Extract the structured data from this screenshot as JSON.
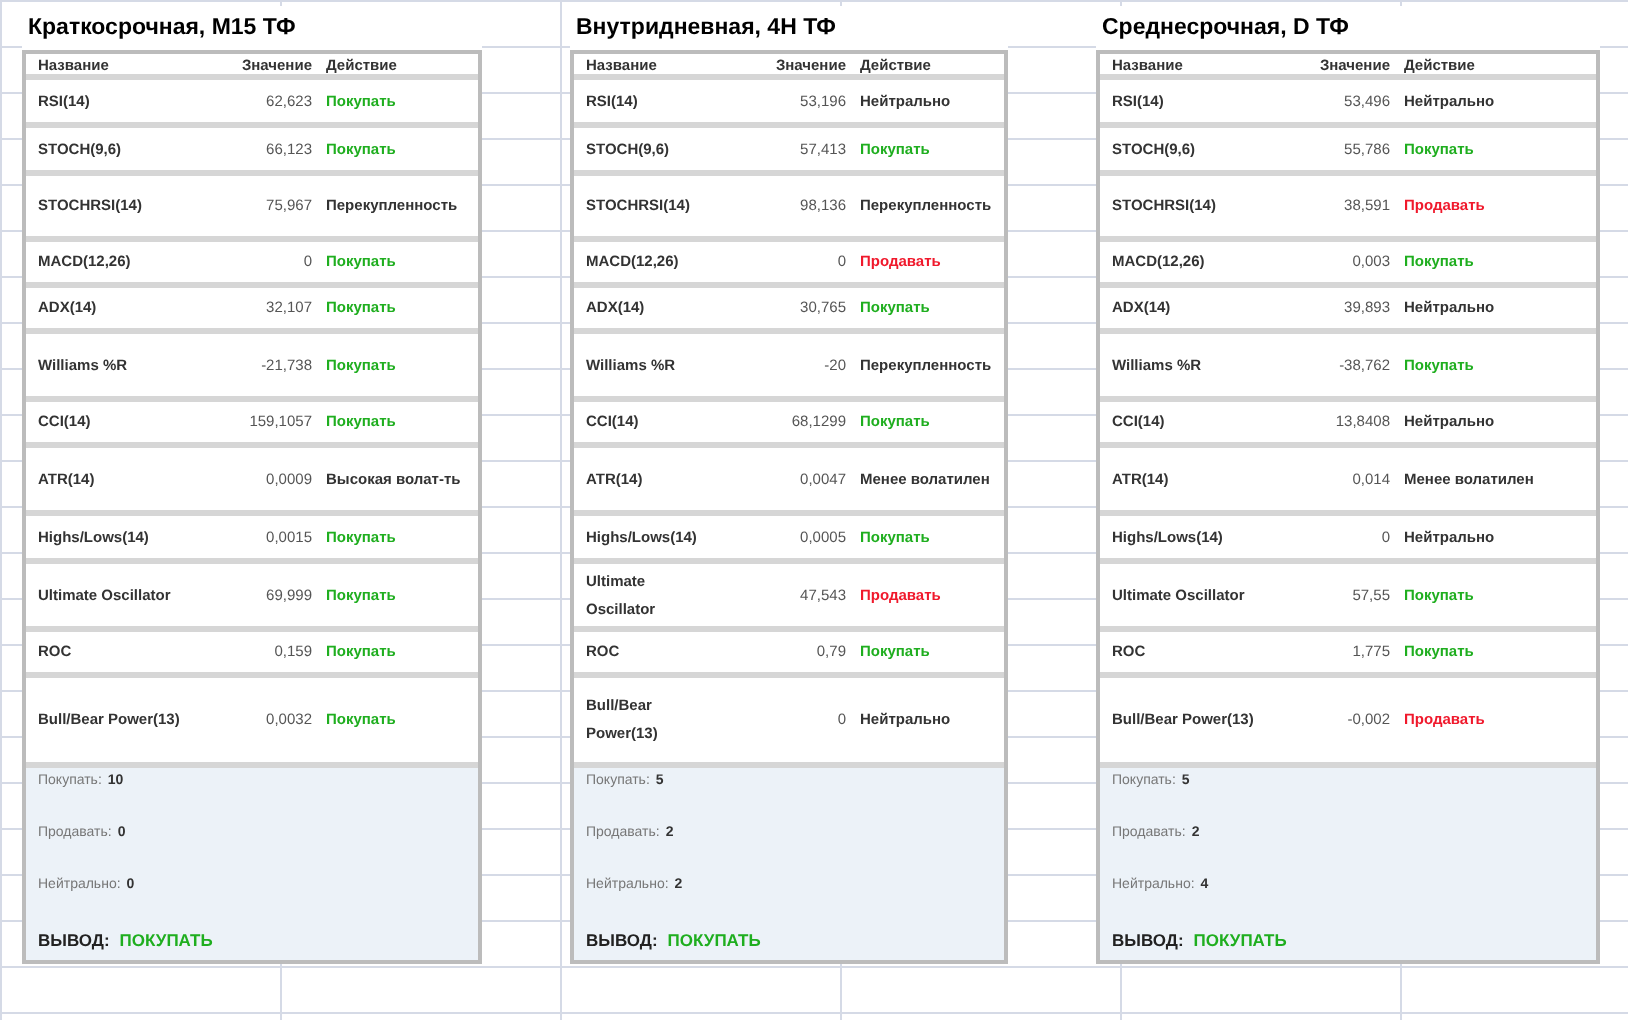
{
  "panels": [
    {
      "title": "Краткосрочная, M15 ТФ",
      "columns": [
        "Название",
        "Значение",
        "Действие"
      ],
      "rows": [
        {
          "name": "RSI(14)",
          "value": "62,623",
          "action": "Покупать",
          "kind": "buy"
        },
        {
          "name": "STOCH(9,6)",
          "value": "66,123",
          "action": "Покупать",
          "kind": "buy"
        },
        {
          "name": "STOCHRSI(14)",
          "value": "75,967",
          "action": "Перекупленность",
          "kind": "neutral"
        },
        {
          "name": "MACD(12,26)",
          "value": "0",
          "action": "Покупать",
          "kind": "buy"
        },
        {
          "name": "ADX(14)",
          "value": "32,107",
          "action": "Покупать",
          "kind": "buy"
        },
        {
          "name": "Williams %R",
          "value": "-21,738",
          "action": "Покупать",
          "kind": "buy"
        },
        {
          "name": "CCI(14)",
          "value": "159,1057",
          "action": "Покупать",
          "kind": "buy"
        },
        {
          "name": "ATR(14)",
          "value": "0,0009",
          "action": "Высокая волат-ть",
          "kind": "neutral"
        },
        {
          "name": "Highs/Lows(14)",
          "value": "0,0015",
          "action": "Покупать",
          "kind": "buy"
        },
        {
          "name": "Ultimate Oscillator",
          "value": "69,999",
          "action": "Покупать",
          "kind": "buy"
        },
        {
          "name": "ROC",
          "value": "0,159",
          "action": "Покупать",
          "kind": "buy"
        },
        {
          "name": "Bull/Bear Power(13)",
          "value": "0,0032",
          "action": "Покупать",
          "kind": "buy"
        }
      ],
      "summary": [
        {
          "label": "Покупать:",
          "count": "10"
        },
        {
          "label": "Продавать:",
          "count": "0"
        },
        {
          "label": "Нейтрально:",
          "count": "0"
        }
      ],
      "conclusion": {
        "label": "ВЫВОД:",
        "value": "ПОКУПАТЬ",
        "kind": "buy"
      }
    },
    {
      "title": "Внутридневная, 4H ТФ",
      "columns": [
        "Название",
        "Значение",
        "Действие"
      ],
      "rows": [
        {
          "name": "RSI(14)",
          "value": "53,196",
          "action": "Нейтрально",
          "kind": "neutral"
        },
        {
          "name": "STOCH(9,6)",
          "value": "57,413",
          "action": "Покупать",
          "kind": "buy"
        },
        {
          "name": "STOCHRSI(14)",
          "value": "98,136",
          "action": "Перекупленность",
          "kind": "neutral"
        },
        {
          "name": "MACD(12,26)",
          "value": "0",
          "action": "Продавать",
          "kind": "sell"
        },
        {
          "name": "ADX(14)",
          "value": "30,765",
          "action": "Покупать",
          "kind": "buy"
        },
        {
          "name": "Williams %R",
          "value": "-20",
          "action": "Перекупленность",
          "kind": "neutral"
        },
        {
          "name": "CCI(14)",
          "value": "68,1299",
          "action": "Покупать",
          "kind": "buy"
        },
        {
          "name": "ATR(14)",
          "value": "0,0047",
          "action": "Менее волатилен",
          "kind": "neutral"
        },
        {
          "name": "Highs/Lows(14)",
          "value": "0,0005",
          "action": "Покупать",
          "kind": "buy"
        },
        {
          "name": "Ultimate Oscillator",
          "value": "47,543",
          "action": "Продавать",
          "kind": "sell"
        },
        {
          "name": "ROC",
          "value": "0,79",
          "action": "Покупать",
          "kind": "buy"
        },
        {
          "name": "Bull/Bear Power(13)",
          "value": "0",
          "action": "Нейтрально",
          "kind": "neutral"
        }
      ],
      "summary": [
        {
          "label": "Покупать:",
          "count": "5"
        },
        {
          "label": "Продавать:",
          "count": "2"
        },
        {
          "label": "Нейтрально:",
          "count": "2"
        }
      ],
      "conclusion": {
        "label": "ВЫВОД:",
        "value": "ПОКУПАТЬ",
        "kind": "buy"
      }
    },
    {
      "title": "Среднесрочная, D ТФ",
      "columns": [
        "Название",
        "Значение",
        "Действие"
      ],
      "rows": [
        {
          "name": "RSI(14)",
          "value": "53,496",
          "action": "Нейтрально",
          "kind": "neutral"
        },
        {
          "name": "STOCH(9,6)",
          "value": "55,786",
          "action": "Покупать",
          "kind": "buy"
        },
        {
          "name": "STOCHRSI(14)",
          "value": "38,591",
          "action": "Продавать",
          "kind": "sell"
        },
        {
          "name": "MACD(12,26)",
          "value": "0,003",
          "action": "Покупать",
          "kind": "buy"
        },
        {
          "name": "ADX(14)",
          "value": "39,893",
          "action": "Нейтрально",
          "kind": "neutral"
        },
        {
          "name": "Williams %R",
          "value": "-38,762",
          "action": "Покупать",
          "kind": "buy"
        },
        {
          "name": "CCI(14)",
          "value": "13,8408",
          "action": "Нейтрально",
          "kind": "neutral"
        },
        {
          "name": "ATR(14)",
          "value": "0,014",
          "action": "Менее волатилен",
          "kind": "neutral"
        },
        {
          "name": "Highs/Lows(14)",
          "value": "0",
          "action": "Нейтрально",
          "kind": "neutral"
        },
        {
          "name": "Ultimate Oscillator",
          "value": "57,55",
          "action": "Покупать",
          "kind": "buy"
        },
        {
          "name": "ROC",
          "value": "1,775",
          "action": "Покупать",
          "kind": "buy"
        },
        {
          "name": "Bull/Bear Power(13)",
          "value": "-0,002",
          "action": "Продавать",
          "kind": "sell"
        }
      ],
      "summary": [
        {
          "label": "Покупать:",
          "count": "5"
        },
        {
          "label": "Продавать:",
          "count": "2"
        },
        {
          "label": "Нейтрально:",
          "count": "4"
        }
      ],
      "conclusion": {
        "label": "ВЫВОД:",
        "value": "ПОКУПАТЬ",
        "kind": "buy"
      }
    }
  ]
}
